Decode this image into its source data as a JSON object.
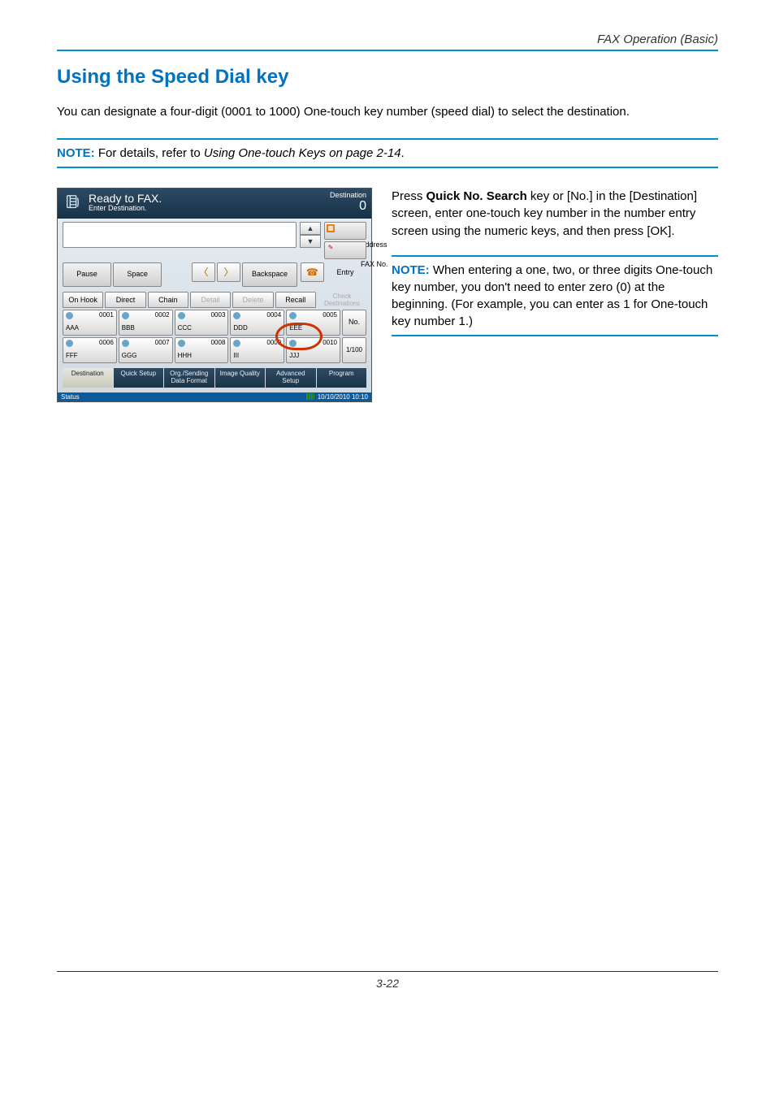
{
  "page": {
    "header_right": "FAX Operation (Basic)",
    "heading": "Using the Speed Dial key",
    "intro": "You can designate a four-digit (0001 to 1000) One-touch key number (speed dial) to select the destination.",
    "note1_label": "NOTE:",
    "note1_text": " For details, refer to ",
    "note1_ref": "Using One-touch Keys on page 2-14",
    "note1_tail": ".",
    "right_para_prefix": "Press ",
    "right_para_bold": "Quick No. Search",
    "right_para_suffix": " key or [No.] in the [Destination] screen, enter one-touch key number in the number entry screen using the numeric keys, and then press [OK].",
    "note2_label": "NOTE:",
    "note2_text": " When entering a one, two, or three digits One-touch key number, you don't need to enter zero (0) at the beginning. (For example, you can enter as 1 for One-touch key number 1.)",
    "footer": "3-22"
  },
  "panel": {
    "title": "Ready to FAX.",
    "subtitle": "Enter Destination.",
    "dest_label": "Destination",
    "dest_count": "0",
    "side": {
      "address_book": "Address\nBook",
      "fax_entry": "FAX No.\nEntry"
    },
    "row2": {
      "pause": "Pause",
      "space": "Space",
      "backspace": "Backspace"
    },
    "tabs": {
      "onhook": "On Hook",
      "direct": "Direct",
      "chain": "Chain",
      "detail": "Detail",
      "delete": "Delete",
      "recall": "Recall"
    },
    "check_dest": "Check\nDestinations",
    "keys": [
      {
        "num": "0001",
        "name": "AAA"
      },
      {
        "num": "0002",
        "name": "BBB"
      },
      {
        "num": "0003",
        "name": "CCC"
      },
      {
        "num": "0004",
        "name": "DDD"
      },
      {
        "num": "0005",
        "name": "EEE"
      },
      {
        "num": "0006",
        "name": "FFF"
      },
      {
        "num": "0007",
        "name": "GGG"
      },
      {
        "num": "0008",
        "name": "HHH"
      },
      {
        "num": "0009",
        "name": "III"
      },
      {
        "num": "0010",
        "name": "JJJ"
      }
    ],
    "no_btn": "No.",
    "page_ind": "1/100",
    "bottom_tabs": {
      "destination": "Destination",
      "quick": "Quick Setup",
      "org": "Org./Sending\nData Format",
      "image": "Image Quality",
      "advanced": "Advanced\nSetup",
      "program": "Program"
    },
    "status": {
      "label": "Status",
      "datetime": "10/10/2010  10:10"
    }
  }
}
